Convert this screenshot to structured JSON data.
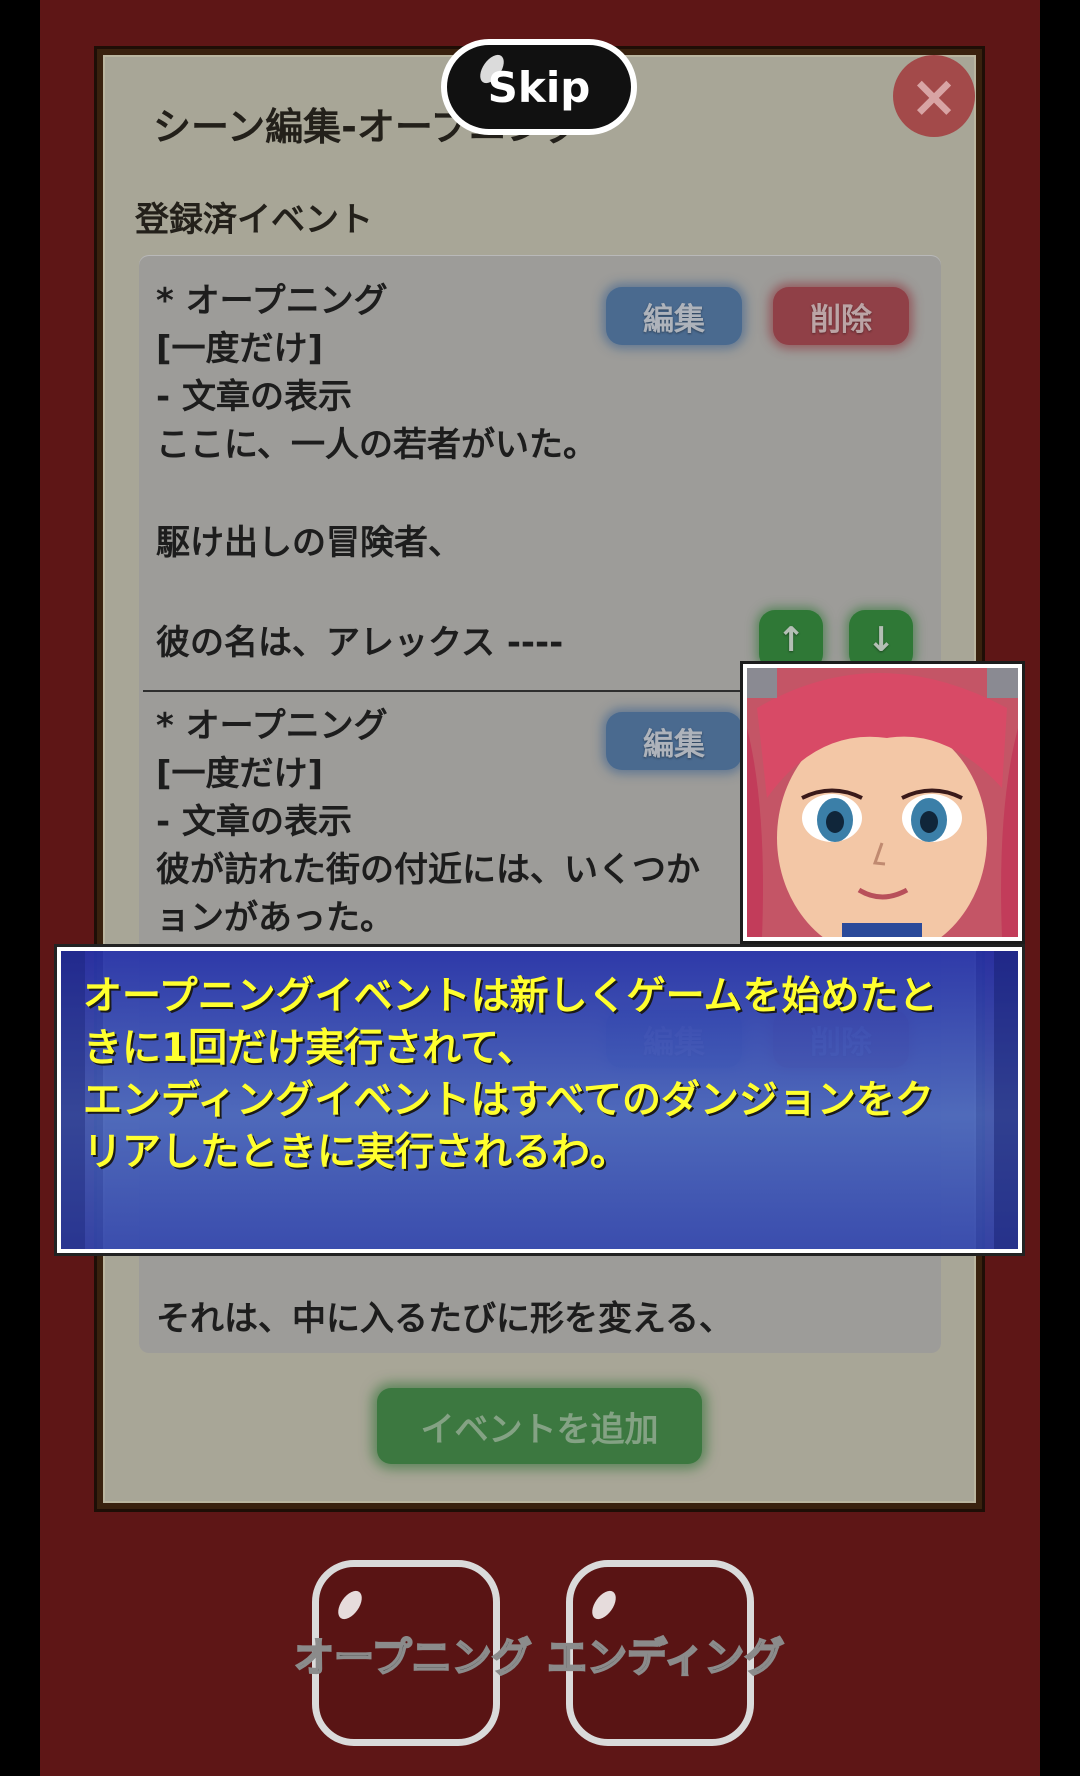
{
  "skip_label": "Skip",
  "close_symbol": "×",
  "scene_title": "シーン編集-オープニング",
  "section_label": "登録済イベント",
  "events": [
    {
      "lines": [
        "* オープニング",
        "[一度だけ]",
        "- 文章の表示",
        "ここに、一人の若者がいた。",
        "駆け出しの冒険者、",
        "彼の名は、アレックス ----"
      ],
      "edit_label": "編集",
      "delete_label": "削除",
      "up_symbol": "↑",
      "down_symbol": "↓"
    },
    {
      "lines": [
        "* オープニング",
        "[一度だけ]",
        "- 文章の表示",
        "彼が訪れた街の付近には、いくつか",
        "ョンがあった。"
      ],
      "edit_label": "編集",
      "delete_label": "削除"
    },
    {
      "lines": [
        "それは、中に入るたびに形を変える、"
      ]
    }
  ],
  "add_event_label": "イベントを追加",
  "tabs": [
    "オープニング",
    "エンディング"
  ],
  "message_lines": [
    "オープニングイベントは新しくゲームを始めたと",
    "きに1回だけ実行されて、",
    "エンディングイベントはすべてのダンジョンをク",
    "リアしたときに実行されるわ。"
  ],
  "colors": {
    "message_text": "#ffff2e",
    "message_bg": "#3a4ab4",
    "edit_button": "#5f88b8",
    "delete_button": "#b9525b",
    "arrow_button": "#3d9a46",
    "add_button": "#4e9a53"
  }
}
